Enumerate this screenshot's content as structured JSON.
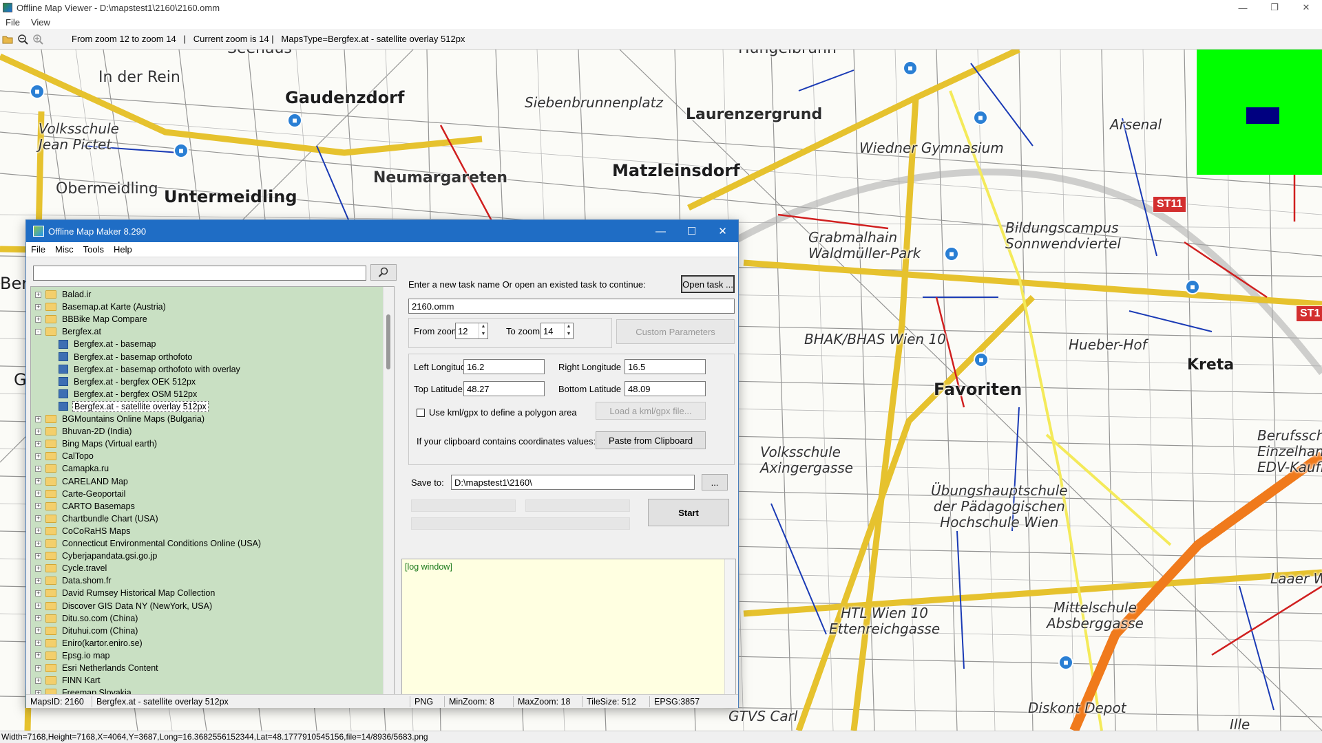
{
  "outer": {
    "title": "Offline Map Viewer - D:\\mapstest1\\2160\\2160.omm",
    "menu": [
      "File",
      "View"
    ],
    "toolbar_info": "From zoom 12 to zoom 14   |   Current zoom is 14 |   MapsType=Bergfex.at - satellite overlay 512px",
    "status": "Width=7168,Height=7168,X=4064,Y=3687,Long=16.3682556152344,Lat=48.1777910545156,file=14/8936/5683.png"
  },
  "map_labels": {
    "seeshaus": "Seehaus",
    "hungelbrunn": "Hungelbrunn",
    "in_der_rein": "In der Rein",
    "gaudenzdorf": "Gaudenzdorf",
    "siebenbrunnenplatz": "Siebenbrunnenplatz",
    "laurenzergrund": "Laurenzergrund",
    "arsenal": "Arsenal",
    "volksschule_jean": "Volksschule\nJean Pictet",
    "matzleinsdorf": "Matzleinsdorf",
    "wiedner_gymnasium": "Wiedner Gymnasium",
    "neumargareten": "Neumargareten",
    "obermeidling": "Obermeidling",
    "untermeidling": "Untermeidling",
    "st11a": "ST11",
    "st11b": "ST1",
    "grabmalhain": "Grabmalhain\nWaldmüller-Park",
    "bildungscampus": "Bildungscampus\nSonnwendviertel",
    "bhak": "BHAK/BHAS Wien 10",
    "hueber_hof": "Hueber-Hof",
    "kreta": "Kreta",
    "favoriten": "Favoriten",
    "volksschule_axinger": "Volksschule\nAxingergasse",
    "uebungshauptschule": "Übungshauptschule\nder Pädagogischen\nHochschule Wien",
    "berufsschule": "Berufsschu\nEinzelhand\nEDV-Kaufle",
    "laaer": "Laaer W",
    "htl": "HTL Wien 10\nEttenreichgasse",
    "mittelschule": "Mittelschule\nAbsberggasse",
    "diskont": "Diskont Depot",
    "gtvs": "GTVS Carl",
    "ille": "Ille",
    "ber": "Ber",
    "g": "G"
  },
  "dialog": {
    "title": "Offline Map Maker 8.290",
    "menu": [
      "File",
      "Misc",
      "Tools",
      "Help"
    ],
    "search_value": "",
    "tree": [
      {
        "label": "Balad.ir",
        "type": "folder",
        "exp": "+"
      },
      {
        "label": "Basemap.at Karte (Austria)",
        "type": "folder",
        "exp": "+"
      },
      {
        "label": "BBBike Map Compare",
        "type": "folder",
        "exp": "+"
      },
      {
        "label": "Bergfex.at",
        "type": "folder",
        "exp": "-"
      },
      {
        "label": "Bergfex.at - basemap",
        "type": "leaf"
      },
      {
        "label": "Bergfex.at - basemap orthofoto",
        "type": "leaf"
      },
      {
        "label": "Bergfex.at - basemap orthofoto with overlay",
        "type": "leaf"
      },
      {
        "label": "Bergfex.at - bergfex OEK 512px",
        "type": "leaf"
      },
      {
        "label": "Bergfex.at - bergfex OSM 512px",
        "type": "leaf"
      },
      {
        "label": "Bergfex.at - satellite overlay 512px",
        "type": "leaf",
        "selected": true
      },
      {
        "label": "BGMountains Online Maps (Bulgaria)",
        "type": "folder",
        "exp": "+"
      },
      {
        "label": "Bhuvan-2D (India)",
        "type": "folder",
        "exp": "+"
      },
      {
        "label": "Bing Maps (Virtual earth)",
        "type": "folder",
        "exp": "+"
      },
      {
        "label": "CalTopo",
        "type": "folder",
        "exp": "+"
      },
      {
        "label": "Camapka.ru",
        "type": "folder",
        "exp": "+"
      },
      {
        "label": "CARELAND Map",
        "type": "folder",
        "exp": "+"
      },
      {
        "label": "Carte-Geoportail",
        "type": "folder",
        "exp": "+"
      },
      {
        "label": "CARTO Basemaps",
        "type": "folder",
        "exp": "+"
      },
      {
        "label": "Chartbundle Chart (USA)",
        "type": "folder",
        "exp": "+"
      },
      {
        "label": "CoCoRaHS Maps",
        "type": "folder",
        "exp": "+"
      },
      {
        "label": "Connecticut Environmental Conditions Online (USA)",
        "type": "folder",
        "exp": "+"
      },
      {
        "label": "Cyberjapandata.gsi.go.jp",
        "type": "folder",
        "exp": "+"
      },
      {
        "label": "Cycle.travel",
        "type": "folder",
        "exp": "+"
      },
      {
        "label": "Data.shom.fr",
        "type": "folder",
        "exp": "+"
      },
      {
        "label": "David Rumsey Historical Map Collection",
        "type": "folder",
        "exp": "+"
      },
      {
        "label": "Discover GIS Data NY (NewYork, USA)",
        "type": "folder",
        "exp": "+"
      },
      {
        "label": "Ditu.so.com (China)",
        "type": "folder",
        "exp": "+"
      },
      {
        "label": "Dituhui.com (China)",
        "type": "folder",
        "exp": "+"
      },
      {
        "label": "Eniro(kartor.eniro.se)",
        "type": "folder",
        "exp": "+"
      },
      {
        "label": "Epsg.io map",
        "type": "folder",
        "exp": "+"
      },
      {
        "label": "Esri Netherlands Content",
        "type": "folder",
        "exp": "+"
      },
      {
        "label": "FINN Kart",
        "type": "folder",
        "exp": "+"
      },
      {
        "label": "Freemap Slovakia",
        "type": "folder",
        "exp": "+"
      }
    ],
    "task_prompt": "Enter a new task name Or open an existed task to continue:",
    "open_task": "Open task ...",
    "task_name": "2160.omm",
    "from_zoom_label": "From zoom",
    "from_zoom": "12",
    "to_zoom_label": "To zoom",
    "to_zoom": "14",
    "custom_params": "Custom Parameters",
    "left_lon_label": "Left Longitude",
    "left_lon": "16.2",
    "right_lon_label": "Right Longitude",
    "right_lon": "16.5",
    "top_lat_label": "Top Latitude",
    "top_lat": "48.27",
    "bottom_lat_label": "Bottom Latitude",
    "bottom_lat": "48.09",
    "kml_label": "Use kml/gpx to define a polygon area",
    "load_kml": "Load a kml/gpx file...",
    "clipboard_label": "If your clipboard contains coordinates values:",
    "paste_btn": "Paste from Clipboard",
    "save_to_label": "Save to:",
    "save_to": "D:\\mapstest1\\2160\\",
    "browse_btn": "...",
    "start_btn": "Start",
    "log_text": "[log window]",
    "status": {
      "maps_id": "MapsID: 2160",
      "name": "Bergfex.at - satellite overlay 512px",
      "format": "PNG",
      "minzoom": "MinZoom: 8",
      "maxzoom": "MaxZoom: 18",
      "tilesize": "TileSize: 512",
      "epsg": "EPSG:3857"
    }
  }
}
